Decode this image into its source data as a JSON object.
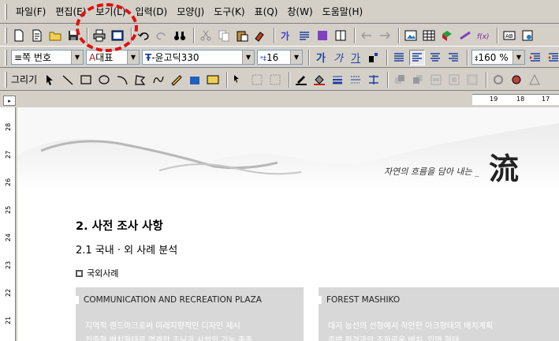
{
  "menu": [
    "파일(F)",
    "편집(E)",
    "보기(L)",
    "입력(D)",
    "모양(J)",
    "도구(K)",
    "표(Q)",
    "창(W)",
    "도움말(H)"
  ],
  "format_bar": {
    "style": "≡쪽 번호",
    "lang": "대표",
    "font": "-윤고딕330",
    "size": "16",
    "bold_label": "가",
    "italic_label": "가",
    "underline_label": "가",
    "zoom": "160 %"
  },
  "draw_bar": {
    "label": "그리기"
  },
  "ruler": {
    "h_numbers": [
      "19",
      "18",
      "17"
    ],
    "v_numbers": [
      "28",
      "27",
      "26",
      "25",
      "24",
      "23",
      "22",
      "21"
    ]
  },
  "document": {
    "slogan": "자연의 흐름을 담아 내는 _",
    "logo": "流",
    "section_title": "2. 사전 조사 사항",
    "sub_title": "2.1 국내 · 외 사례 분석",
    "subsection": "국외사례",
    "cases": [
      {
        "title": "COMMUNICATION AND RECREATION PLAZA",
        "lines": [
          "지역적 랜드마크로써 미래지향적인 디자인 제시",
          "집중형 배치형태로 명쾌한 조닝과 시설의 기능 충족"
        ]
      },
      {
        "title": "FOREST MASHIKO",
        "lines": [
          "대지 능선의 선형에서 착안한 아크형태의 배치계획",
          "주변 환경과의 조화로운 배치, 입면 형태"
        ]
      }
    ]
  },
  "colors": {
    "highlight_circle": "#e01010",
    "chrome": "#d4d0c8"
  }
}
